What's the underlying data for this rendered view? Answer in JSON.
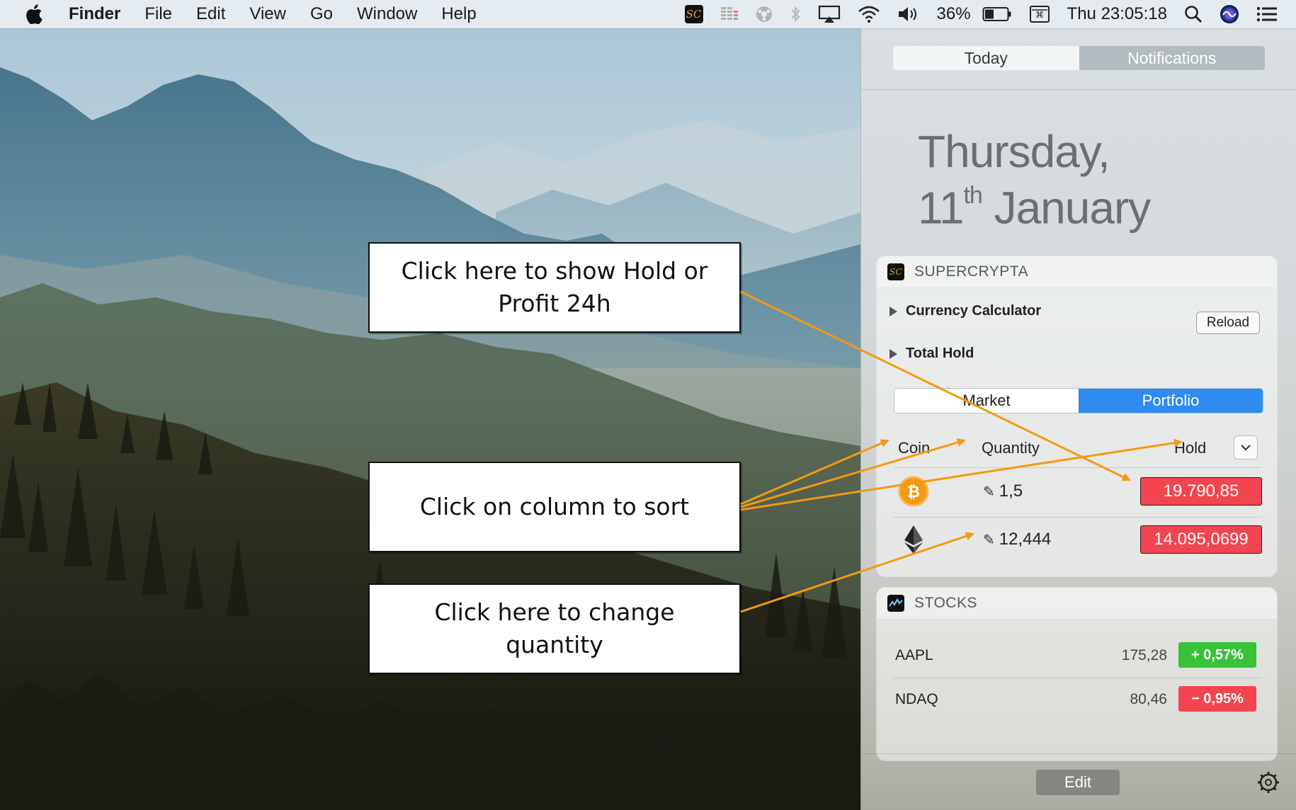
{
  "menubar": {
    "app_name": "Finder",
    "menus": [
      "File",
      "Edit",
      "View",
      "Go",
      "Window",
      "Help"
    ],
    "battery_percent": "36%",
    "clock": "Thu 23:05:18"
  },
  "notification_center": {
    "tabs": [
      "Today",
      "Notifications"
    ],
    "date_line1": "Thursday,",
    "date_day": "11",
    "date_suffix": "th",
    "date_month": "January",
    "supercrypta": {
      "title": "SUPERCRYPTA",
      "currency_calculator": "Currency Calculator",
      "reload": "Reload",
      "total_hold": "Total Hold",
      "segments": [
        "Market",
        "Portfolio"
      ],
      "selected_segment": "Portfolio",
      "columns": {
        "coin": "Coin",
        "quantity": "Quantity",
        "hold": "Hold"
      },
      "rows": [
        {
          "coin": "bitcoin",
          "quantity": "1,5",
          "hold": "19.790,85"
        },
        {
          "coin": "ethereum",
          "quantity": "12,444",
          "hold": "14.095,0699"
        }
      ]
    },
    "stocks": {
      "title": "STOCKS",
      "rows": [
        {
          "symbol": "AAPL",
          "price": "175,28",
          "change": "+ 0,57%",
          "direction": "up"
        },
        {
          "symbol": "NDAQ",
          "price": "80,46",
          "change": "− 0,95%",
          "direction": "down"
        }
      ]
    },
    "edit": "Edit"
  },
  "callouts": {
    "hold_profit_line1": "Click here to show Hold or",
    "hold_profit_line2": "Profit 24h",
    "sort": "Click on column to sort",
    "quantity_line1": "Click here to change",
    "quantity_line2": "quantity"
  },
  "colors": {
    "accent_blue": "#2f8bf0",
    "hold_red": "#f2454f",
    "stock_up": "#37c23a",
    "stock_down": "#f2454f",
    "arrow_orange": "#f39a12"
  }
}
